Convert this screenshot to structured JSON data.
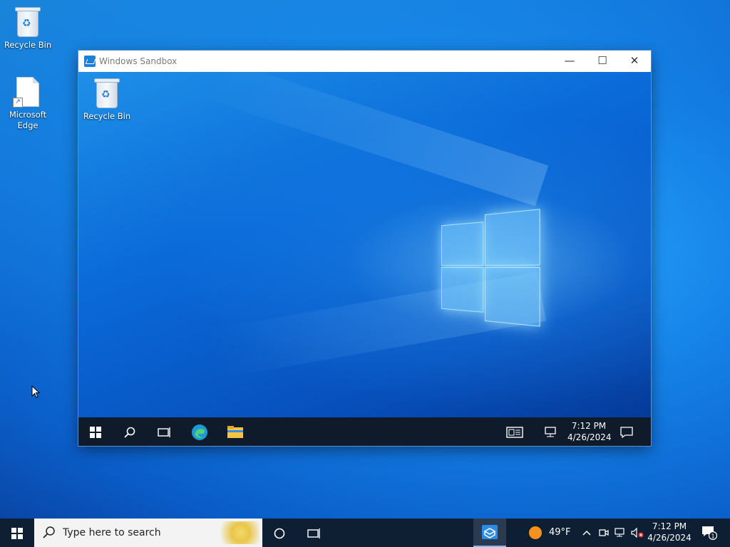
{
  "desktop": {
    "icons": [
      {
        "label": "Recycle Bin"
      },
      {
        "label": "Microsoft Edge"
      }
    ]
  },
  "sandbox": {
    "title": "Windows Sandbox",
    "controls": {
      "minimize": "—",
      "maximize": "☐",
      "close": "✕"
    },
    "desktop_icons": [
      {
        "label": "Recycle Bin"
      }
    ],
    "taskbar": {
      "time": "7:12 PM",
      "date": "4/26/2024"
    }
  },
  "taskbar": {
    "search_placeholder": "Type here to search",
    "weather": "49°F",
    "time": "7:12 PM",
    "date": "4/26/2024",
    "notification_count": "1"
  }
}
